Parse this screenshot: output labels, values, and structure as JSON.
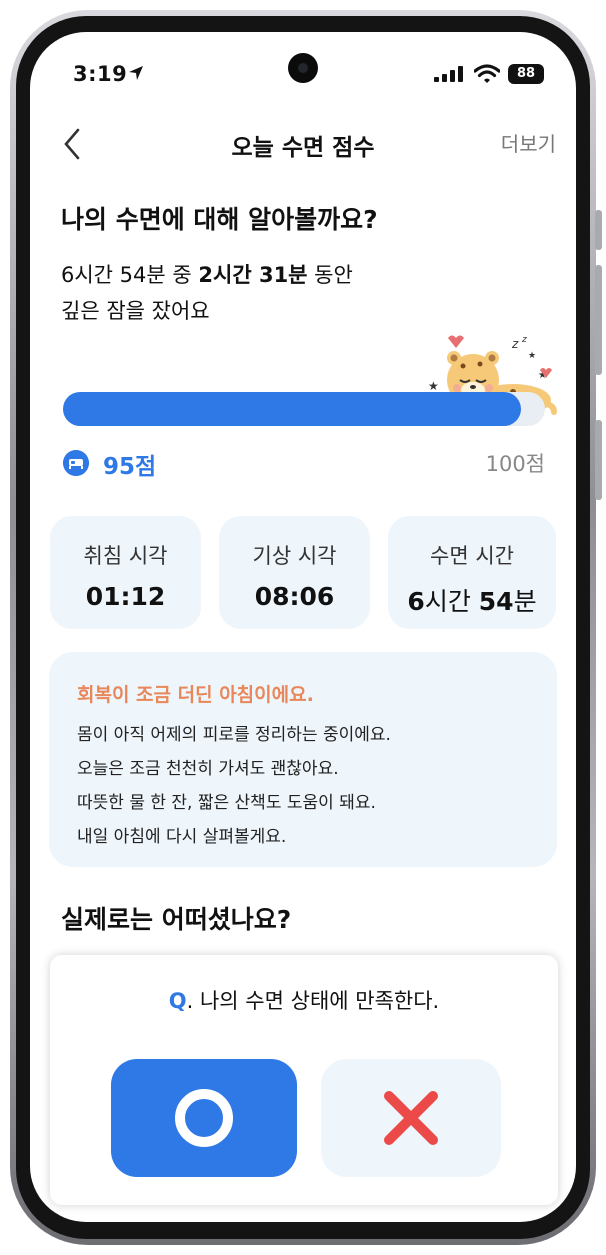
{
  "status_bar": {
    "time": "3:19",
    "battery": "88"
  },
  "nav": {
    "title": "오늘 수면 점수",
    "more": "더보기"
  },
  "headline": "나의 수면에 대해 알아볼까요?",
  "summary": {
    "line1_a": "6시간 54분 중 ",
    "line1_b": "2시간 31분",
    "line1_c": " 동안",
    "line2": "깊은 잠을 잤어요"
  },
  "progress": {
    "score": 95,
    "max": 100
  },
  "score": {
    "value": "95점",
    "max_label": "100점"
  },
  "cards": {
    "bedtime": {
      "label": "취침 시각",
      "value": "01:12"
    },
    "wake": {
      "label": "기상 시각",
      "value": "08:06"
    },
    "duration": {
      "label": "수면 시간",
      "hours": "6",
      "hours_unit": "시간 ",
      "minutes": "54",
      "minutes_unit": "분"
    }
  },
  "message": {
    "title": "회복이 조금 더딘 아침이에요.",
    "lines": [
      "몸이 아직 어제의 피로를 정리하는 중이에요.",
      "오늘은 조금 천천히 가셔도 괜찮아요.",
      "따뜻한 물 한 잔, 짧은 산책도 도움이 돼요.",
      "내일 아침에 다시 살펴볼게요."
    ]
  },
  "question_head": "실제로는 어떠셨나요?",
  "question": {
    "prefix": "Q",
    "text": ". 나의 수면 상태에 만족한다."
  },
  "colors": {
    "accent": "#2e79e6",
    "warning": "#e8875a",
    "card_bg": "#eef5fb",
    "no_x": "#ec4a48"
  }
}
